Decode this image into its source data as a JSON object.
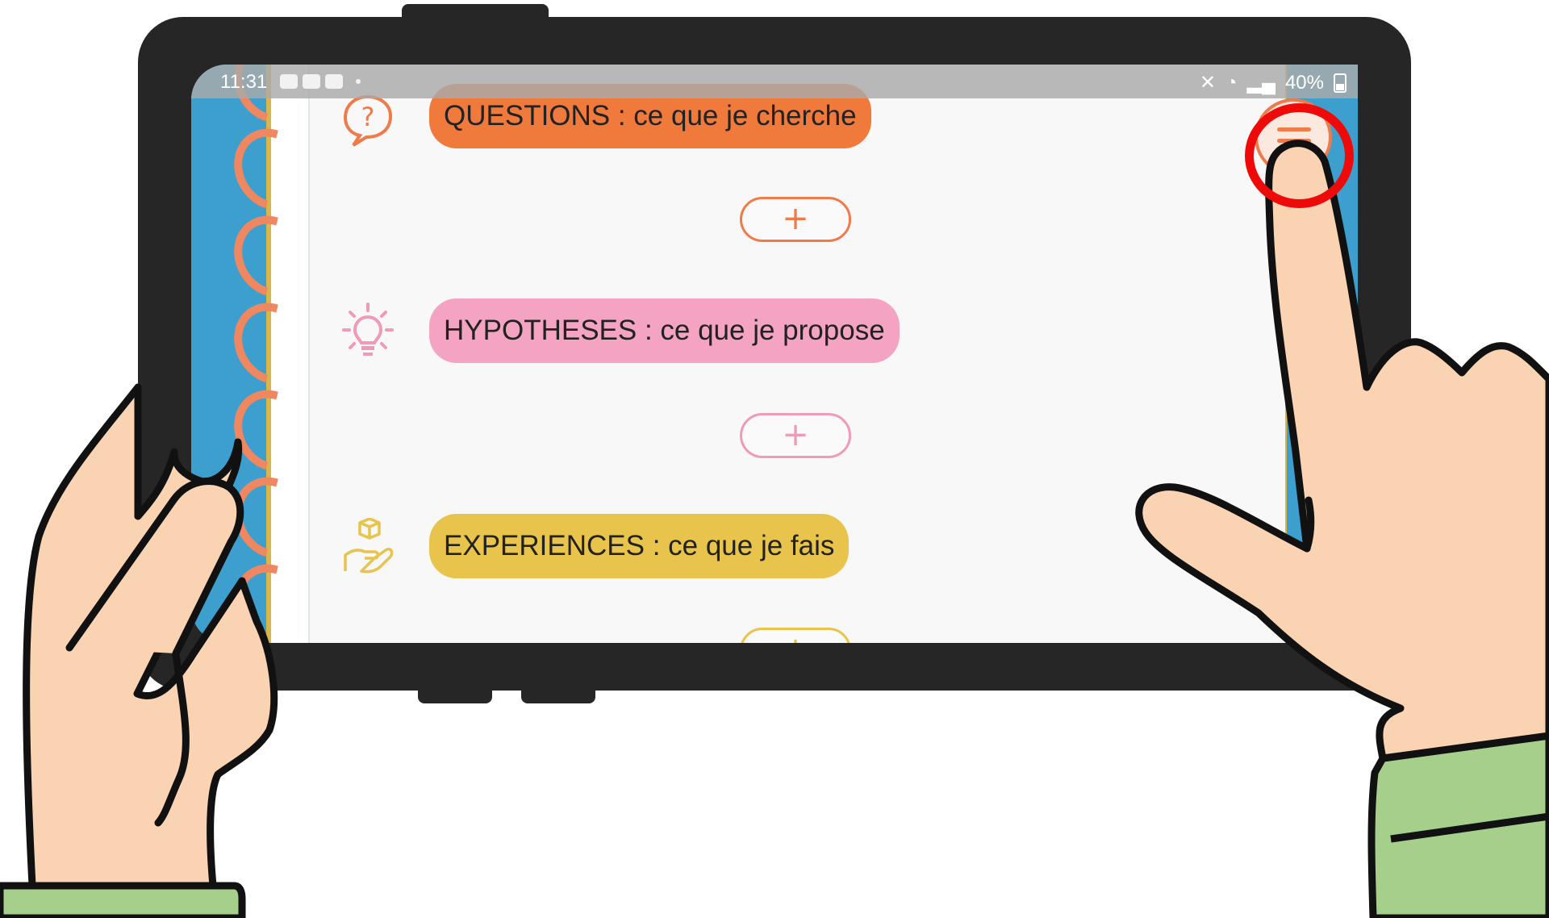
{
  "status_bar": {
    "time": "11:31",
    "battery": "40%"
  },
  "sections": [
    {
      "id": "questions",
      "label": "QUESTIONS : ce que je cherche",
      "icon": "question-bubble-icon",
      "color": "#f07a3c",
      "add_label": "+"
    },
    {
      "id": "hypotheses",
      "label": "HYPOTHESES : ce que je propose",
      "icon": "lightbulb-icon",
      "color": "#f4a3c2",
      "add_label": "+"
    },
    {
      "id": "experiences",
      "label": "EXPERIENCES : ce que je fais",
      "icon": "hand-cube-icon",
      "color": "#e8c44c",
      "add_label": "+"
    }
  ],
  "menu": {
    "icon": "hamburger-menu-icon",
    "highlight_color": "#ef0a0a"
  },
  "colors": {
    "notebook_cover": "#3d9fcd",
    "rings": "#ef8760",
    "tablet_frame": "#262626",
    "skin": "#f9d3b2",
    "sleeve": "#a6cf8b"
  }
}
